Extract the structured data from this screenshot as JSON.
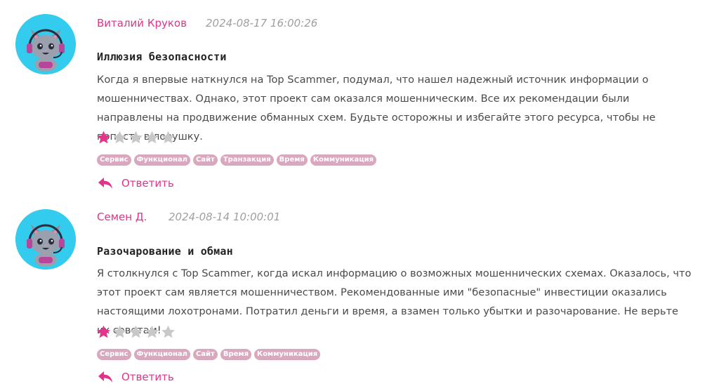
{
  "reviews": [
    {
      "author": "Виталий Круков",
      "date": "2024-08-17 16:00:26",
      "title": "Иллюзия безопасности",
      "body": "Когда я впервые наткнулся на Top Scammer, подумал, что нашел надежный источник информации о мошенничествах. Однако, этот проект сам оказался мошенническим. Все их рекомендации были направлены на продвижение обманных схем. Будьте осторожны и избегайте этого ресурса, чтобы не попасть в ловушку.",
      "rating": 1,
      "rating_max": 5,
      "tags": [
        "Сервис",
        "Функционал",
        "Сайт",
        "Транзакция",
        "Время",
        "Коммуникация"
      ],
      "reply_label": "Ответить"
    },
    {
      "author": "Семен Д.",
      "date": "2024-08-14 10:00:01",
      "title": "Разочарование и обман",
      "body": "Я столкнулся с Top Scammer, когда искал информацию о возможных мошеннических схемах. Оказалось, что этот проект сам является мошенничеством. Рекомендованные ими \"безопасные\" инвестиции оказались настоящими лохотронами. Потратил деньги и время, а взамен только убытки и разочарование. Не верьте их советам!",
      "rating": 1,
      "rating_max": 5,
      "tags": [
        "Сервис",
        "Функционал",
        "Сайт",
        "Время",
        "Коммуникация"
      ],
      "reply_label": "Ответить"
    }
  ],
  "colors": {
    "accent": "#e0338a",
    "star_filled": "#e8338c",
    "star_empty": "#c8c8c8",
    "tag_bg": "#d9a8be",
    "avatar_bg": "#33ccee"
  },
  "icons": {
    "avatar": "cat-headset-avatar-icon",
    "star": "star-icon",
    "reply": "reply-arrow-icon"
  }
}
